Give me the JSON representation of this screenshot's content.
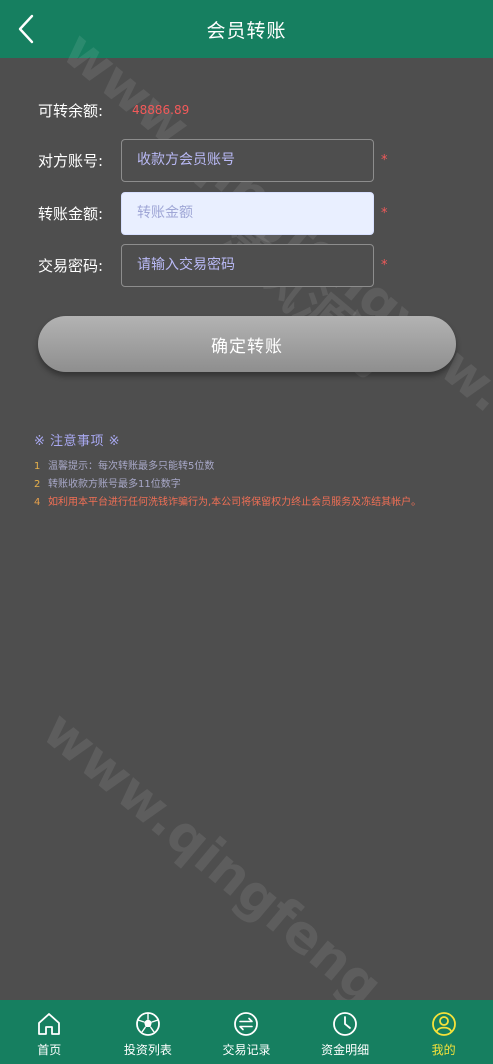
{
  "header": {
    "title": "会员转账",
    "back_icon": "chevron-left-icon"
  },
  "form": {
    "balance_label": "可转余额:",
    "balance_value": "48886.89",
    "account_label": "对方账号:",
    "account_placeholder": "收款方会员账号",
    "amount_label": "转账金额:",
    "amount_placeholder": "转账金额",
    "password_label": "交易密码:",
    "password_placeholder": "请输入交易密码",
    "required_mark": "*",
    "submit_label": "确定转账"
  },
  "notice": {
    "title": "※ 注意事项 ※",
    "items": [
      {
        "num": "1",
        "text": "温馨提示：每次转账最多只能转5位数"
      },
      {
        "num": "2",
        "text": "转账收款方账号最多11位数字"
      },
      {
        "num": "4",
        "text": "如利用本平台进行任何洗钱诈骗行为,本公司将保留权力终止会员服务及冻结其帐户。"
      }
    ]
  },
  "watermark": {
    "text_top": "www.qingfengynw.cn",
    "text_cn": "清风源码",
    "text_bottom": "www.qingfeng"
  },
  "tabbar": {
    "items": [
      {
        "label": "首页",
        "icon": "home-icon"
      },
      {
        "label": "投资列表",
        "icon": "football-icon"
      },
      {
        "label": "交易记录",
        "icon": "exchange-icon"
      },
      {
        "label": "资金明细",
        "icon": "clock-icon"
      },
      {
        "label": "我的",
        "icon": "user-icon"
      }
    ],
    "active_index": 4
  },
  "colors": {
    "header_bg": "#167f60",
    "page_bg": "#4e4e4e",
    "balance": "#f35a5a",
    "active_tab": "#f5e23a"
  }
}
